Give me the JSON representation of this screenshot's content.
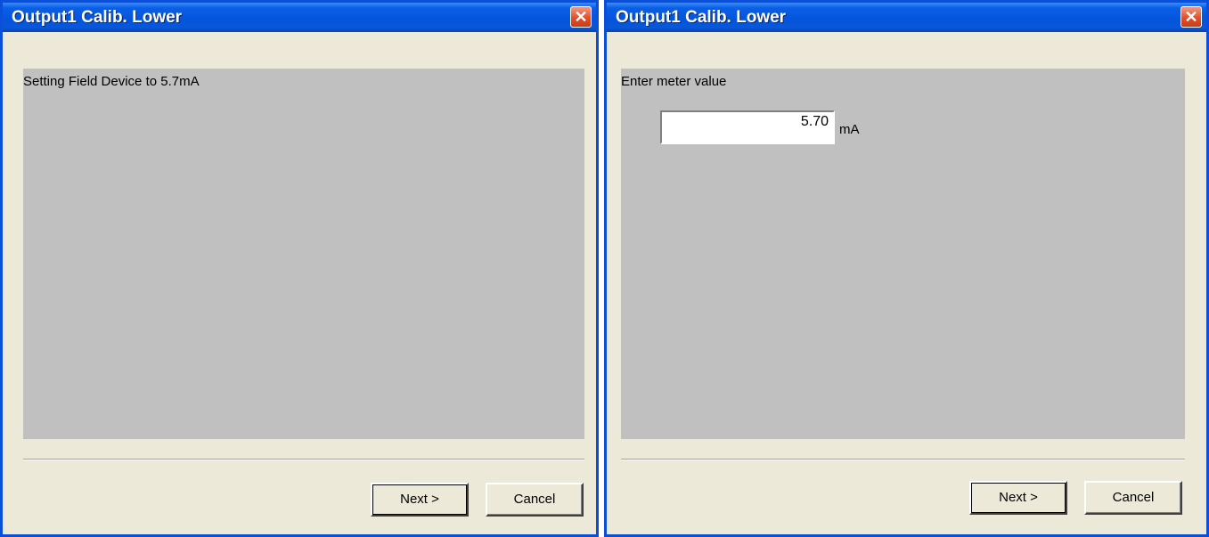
{
  "dialogs": [
    {
      "title": "Output1 Calib. Lower",
      "message": "Setting Field Device to 5.7mA",
      "buttons": {
        "next": "Next >",
        "cancel": "Cancel"
      }
    },
    {
      "title": "Output1 Calib. Lower",
      "message": "Enter meter value",
      "meter_value": "5.70",
      "unit": "mA",
      "buttons": {
        "next": "Next >",
        "cancel": "Cancel"
      }
    }
  ],
  "icons": {
    "close": "close-icon"
  },
  "colors": {
    "titlebar": "#0454dc",
    "close_button": "#e0502b",
    "panel": "#c0c0c0",
    "dialog_bg": "#ece9d8"
  }
}
